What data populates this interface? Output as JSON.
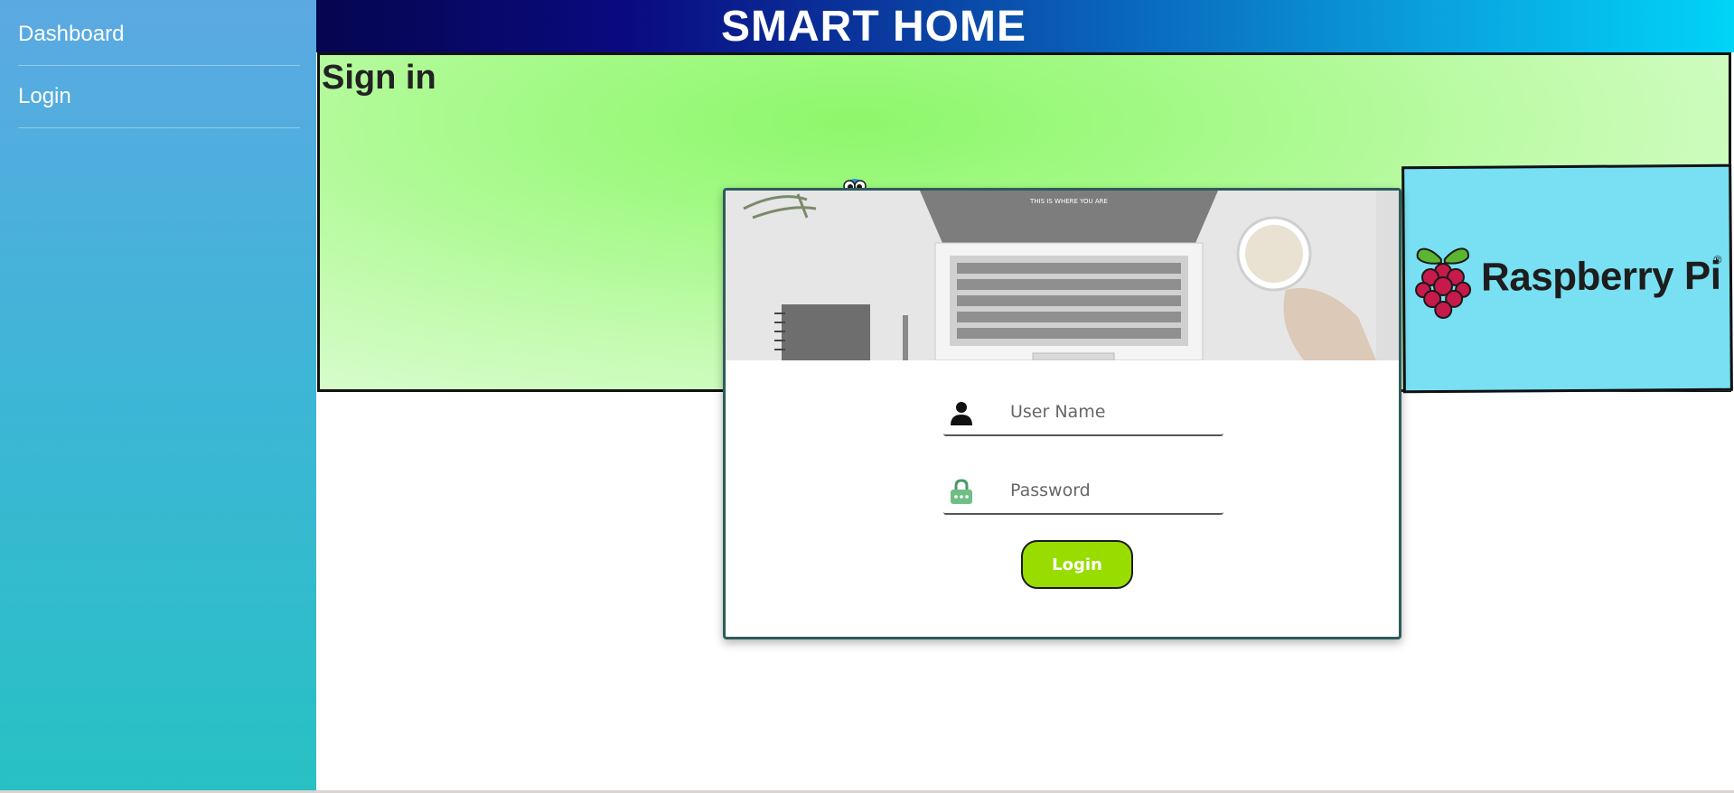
{
  "header": {
    "title": "SMART HOME"
  },
  "sidebar": {
    "items": [
      {
        "label": "Dashboard"
      },
      {
        "label": "Login"
      }
    ]
  },
  "banner": {
    "title": "Sign in"
  },
  "rpi_panel": {
    "brand": "Raspberry Pi",
    "trademark": "®"
  },
  "login_card": {
    "image_caption": "THIS IS WHERE YOU ARE",
    "username": {
      "placeholder": "User Name",
      "value": "",
      "icon": "user-icon"
    },
    "password": {
      "placeholder": "Password",
      "value": "",
      "icon": "lock-icon"
    },
    "submit_label": "Login"
  },
  "colors": {
    "sidebar_top": "#5ca9e2",
    "sidebar_bottom": "#27c1c4",
    "header_start": "#05054f",
    "header_end": "#00d4f7",
    "banner_green": "#8df76a",
    "rpi_panel": "#78e0f2",
    "login_button": "#99dd00",
    "card_border": "#2e5b5b"
  }
}
